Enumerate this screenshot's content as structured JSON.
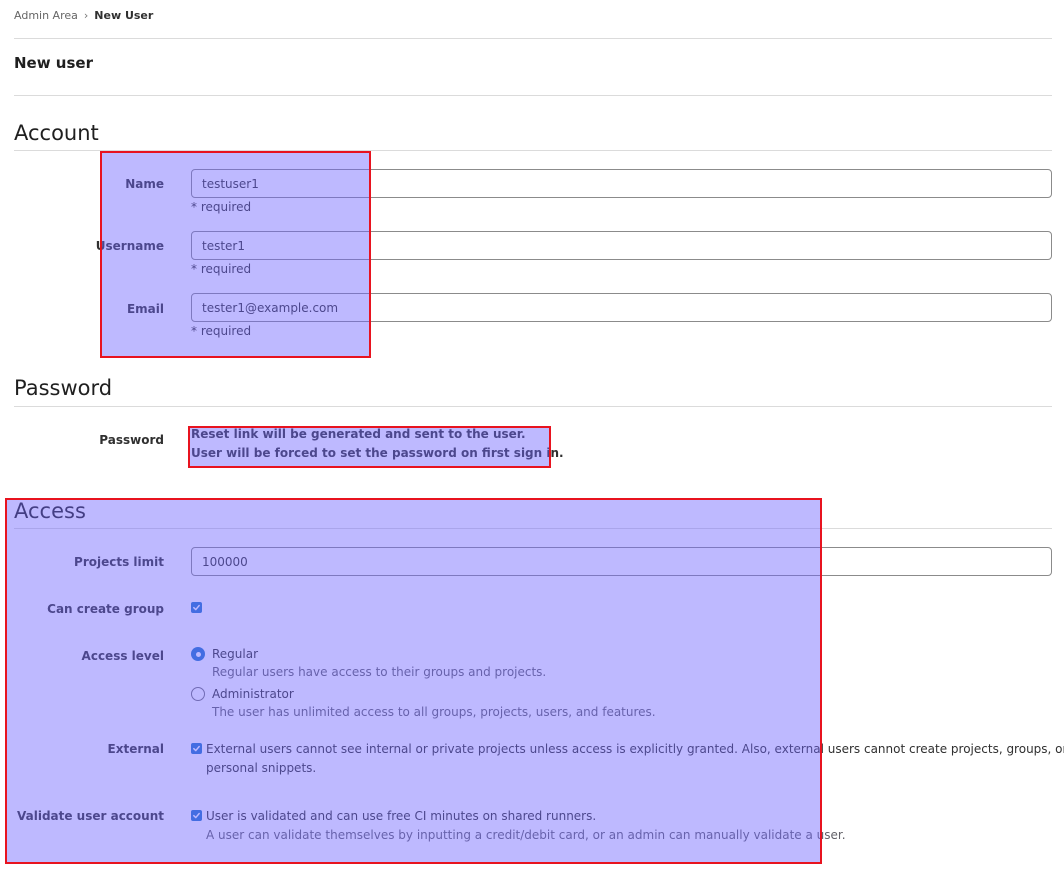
{
  "breadcrumb": {
    "parent": "Admin Area",
    "separator": "›",
    "current": "New User"
  },
  "page_title": "New user",
  "account": {
    "title": "Account",
    "fields": [
      {
        "label": "Name",
        "value": "testuser1",
        "help": "* required"
      },
      {
        "label": "Username",
        "value": "tester1",
        "help": "* required"
      },
      {
        "label": "Email",
        "value": "tester1@example.com",
        "help": "* required"
      }
    ]
  },
  "password": {
    "title": "Password",
    "label": "Password",
    "line1": "Reset link will be generated and sent to the user.",
    "line2": "User will be forced to set the password on first sign in."
  },
  "access": {
    "title": "Access",
    "projects_limit": {
      "label": "Projects limit",
      "value": "100000"
    },
    "can_create_group": {
      "label": "Can create group",
      "checked": true
    },
    "access_level": {
      "label": "Access level",
      "options": [
        {
          "label": "Regular",
          "desc": "Regular users have access to their groups and projects.",
          "selected": true
        },
        {
          "label": "Administrator",
          "desc": "The user has unlimited access to all groups, projects, users, and features.",
          "selected": false
        }
      ]
    },
    "external": {
      "label": "External",
      "checked": true,
      "line1": "External users cannot see internal or private projects unless access is explicitly granted. Also, external users cannot create projects, groups, or",
      "line2": "personal snippets."
    },
    "validate": {
      "label": "Validate user account",
      "checked": true,
      "text": "User is validated and can use free CI minutes on shared runners.",
      "desc": "A user can validate themselves by inputting a credit/debit card, or an admin can manually validate a user."
    }
  },
  "colors": {
    "accent": "#1f75cb",
    "highlight_fill": "#6e64ff",
    "highlight_border": "#e8131f"
  }
}
